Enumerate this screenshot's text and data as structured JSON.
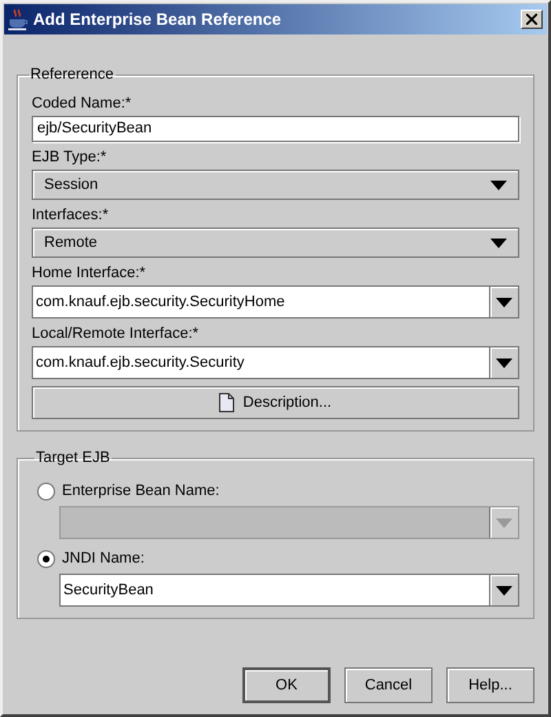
{
  "window": {
    "title": "Add Enterprise Bean Reference"
  },
  "reference": {
    "title": "Refererence",
    "fields": [
      {
        "kind": "text",
        "label": "Coded Name:*",
        "value": "ejb/SecurityBean"
      },
      {
        "kind": "choice",
        "label": "EJB Type:*",
        "value": "Session"
      },
      {
        "kind": "choice",
        "label": "Interfaces:*",
        "value": "Remote"
      },
      {
        "kind": "editable_choice",
        "label": "Home Interface:*",
        "value": "com.knauf.ejb.security.SecurityHome"
      },
      {
        "kind": "editable_choice",
        "label": "Local/Remote Interface:*",
        "value": "com.knauf.ejb.security.Security"
      }
    ],
    "button": "Description..."
  },
  "target": {
    "title": "Target EJB",
    "options": [
      {
        "label": "Enterprise Bean Name:",
        "selected": false,
        "disabled": true
      },
      {
        "label": "JNDI Name:",
        "selected": true,
        "disabled": false,
        "value": "SecurityBean"
      }
    ]
  },
  "buttons": [
    {
      "label": "OK",
      "default": true
    },
    {
      "label": "Cancel",
      "default": false
    },
    {
      "label": "Help...",
      "default": false
    }
  ]
}
